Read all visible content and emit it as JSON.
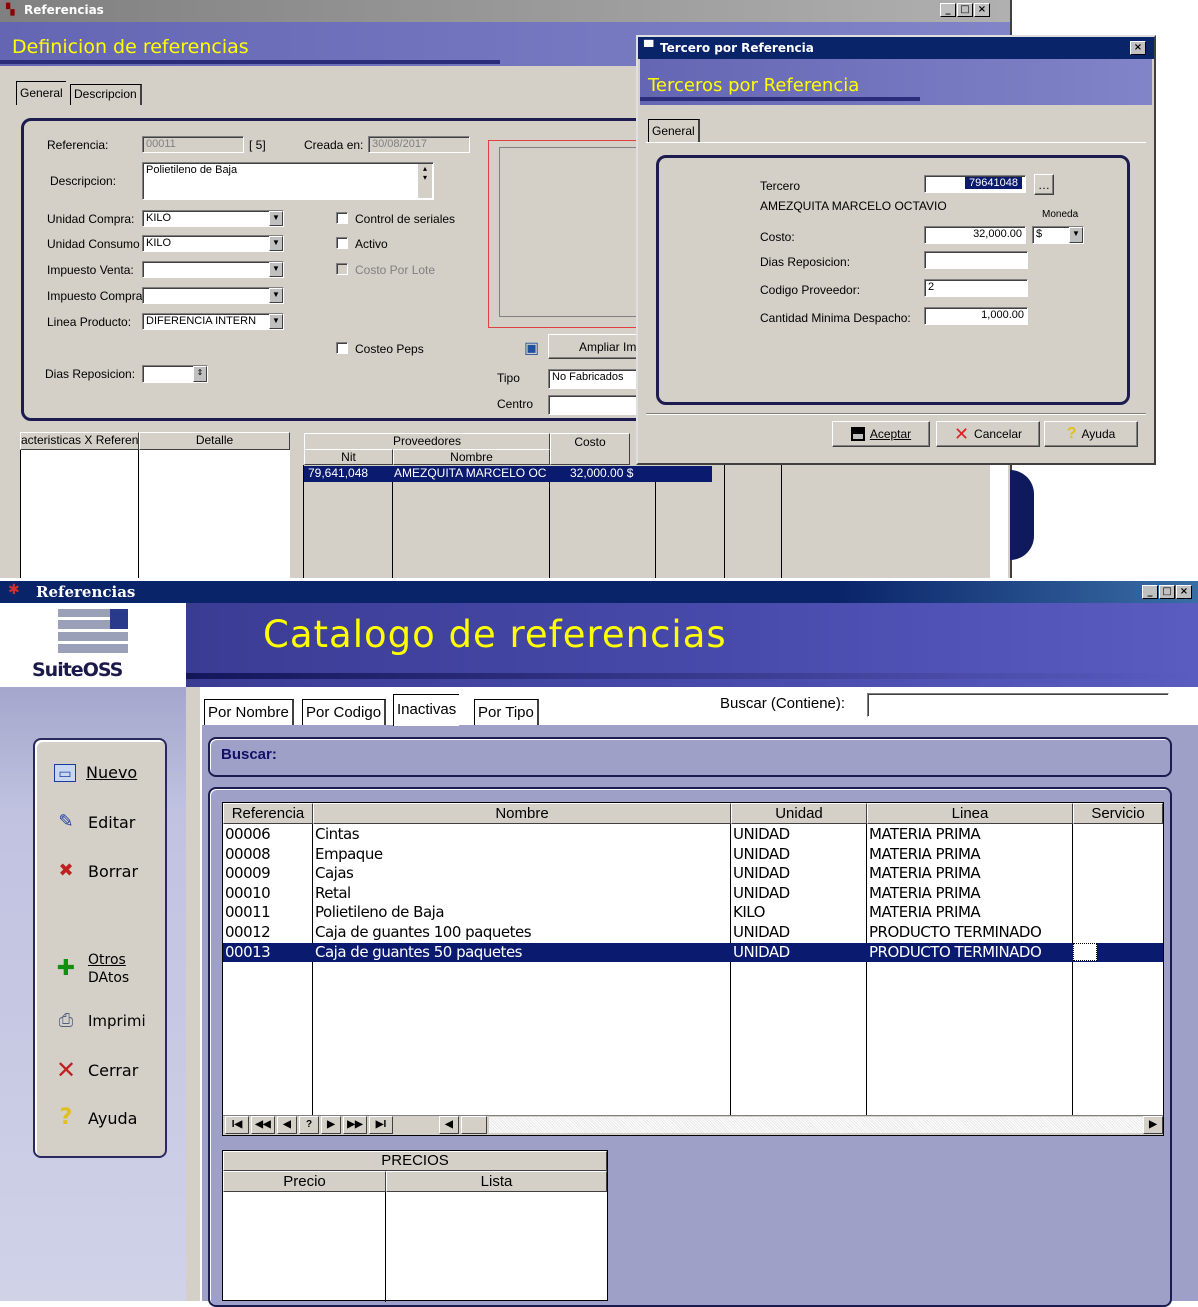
{
  "colors": {
    "accent": "#ffff00",
    "navy": "#000080",
    "selected": "#0a1a6e",
    "panel": "#9fa0c8"
  },
  "bg": {
    "title": "Referencias",
    "header": "Definicion de referencias",
    "tabs": [
      "General",
      "Descripcion"
    ],
    "referencia_label": "Referencia:",
    "referencia_value": "00011",
    "referencia_count": "[ 5]",
    "creada_label": "Creada en:",
    "creada_value": "30/08/2017",
    "descripcion_label": "Descripcion:",
    "descripcion_value": "Polietileno de Baja",
    "unidad_compra_label": "Unidad Compra:",
    "unidad_compra_value": "KILO",
    "unidad_consumo_label": "Unidad Consumo",
    "unidad_consumo_value": "KILO",
    "impuesto_venta_label": "Impuesto Venta:",
    "impuesto_compra_label": "Impuesto Compra",
    "linea_label": "Linea  Producto:",
    "linea_value": "DIFERENCIA INTERN",
    "control_seriales": "Control de seriales",
    "activo": "Activo",
    "costo_lote": "Costo Por Lote",
    "costeo_peps": "Costeo Peps",
    "dias_label": "Dias Reposicion:",
    "ampliar": "Ampliar Im",
    "tipo_label": "Tipo",
    "tipo_value": "No Fabricados",
    "centro_label": "Centro",
    "grid1_hdr": [
      "acteristicas X Referen",
      "Detalle"
    ],
    "prov_hdr": "Proveedores",
    "costo_hdr": "Costo",
    "nit_hdr": "Nit",
    "nombre_hdr": "Nombre",
    "prov_row": {
      "nit": "79,641,048",
      "nombre": "AMEZQUITA MARCELO OC",
      "costo": "32,000.00 $"
    }
  },
  "dialog": {
    "title": "Tercero por Referencia",
    "header": "Terceros por Referencia",
    "tab": "General",
    "tercero_label": "Tercero",
    "tercero_value": "79641048",
    "tercero_name": "AMEZQUITA MARCELO OCTAVIO",
    "moneda_label": "Moneda",
    "moneda_value": "$",
    "costo_label": "Costo:",
    "costo_value": "32,000.00",
    "dias_label": "Dias Reposicion:",
    "codigo_label": "Codigo Proveedor:",
    "codigo_value": "2",
    "cantidad_label": "Cantidad Minima Despacho:",
    "cantidad_value": "1,000.00",
    "aceptar": "Aceptar",
    "cancelar": "Cancelar",
    "ayuda": "Ayuda"
  },
  "main": {
    "title": "Referencias",
    "logo": "SuiteOSS",
    "header": "Catalogo de referencias",
    "tabs": [
      "Por Nombre",
      "Por Codigo",
      "Inactivas",
      "Por Tipo"
    ],
    "buscar_contiene": "Buscar (Contiene):",
    "buscar": "Buscar:",
    "sidebar": [
      "Nuevo",
      "Editar",
      "Borrar",
      "Otros",
      "DAtos",
      "Imprimi",
      "Cerrar",
      "Ayuda"
    ],
    "columns": [
      "Referencia",
      "Nombre",
      "Unidad",
      "Linea",
      "Servicio"
    ],
    "rows": [
      [
        "00006",
        "Cintas",
        "UNIDAD",
        "MATERIA PRIMA"
      ],
      [
        "00008",
        "Empaque",
        "UNIDAD",
        "MATERIA PRIMA"
      ],
      [
        "00009",
        "Cajas",
        "UNIDAD",
        "MATERIA PRIMA"
      ],
      [
        "00010",
        "Retal",
        "UNIDAD",
        "MATERIA PRIMA"
      ],
      [
        "00011",
        "Polietileno de Baja",
        "KILO",
        "MATERIA PRIMA"
      ],
      [
        "00012",
        "Caja de guantes 100 paquetes",
        "UNIDAD",
        "PRODUCTO TERMINADO"
      ],
      [
        "00013",
        "Caja de guantes 50 paquetes",
        "UNIDAD",
        "PRODUCTO TERMINADO"
      ]
    ],
    "selected_row": 6,
    "nav": [
      "I◀",
      "◀◀",
      "◀",
      "?",
      "▶",
      "▶▶",
      "▶I"
    ],
    "precios": "PRECIOS",
    "precio": "Precio",
    "lista": "Lista"
  }
}
